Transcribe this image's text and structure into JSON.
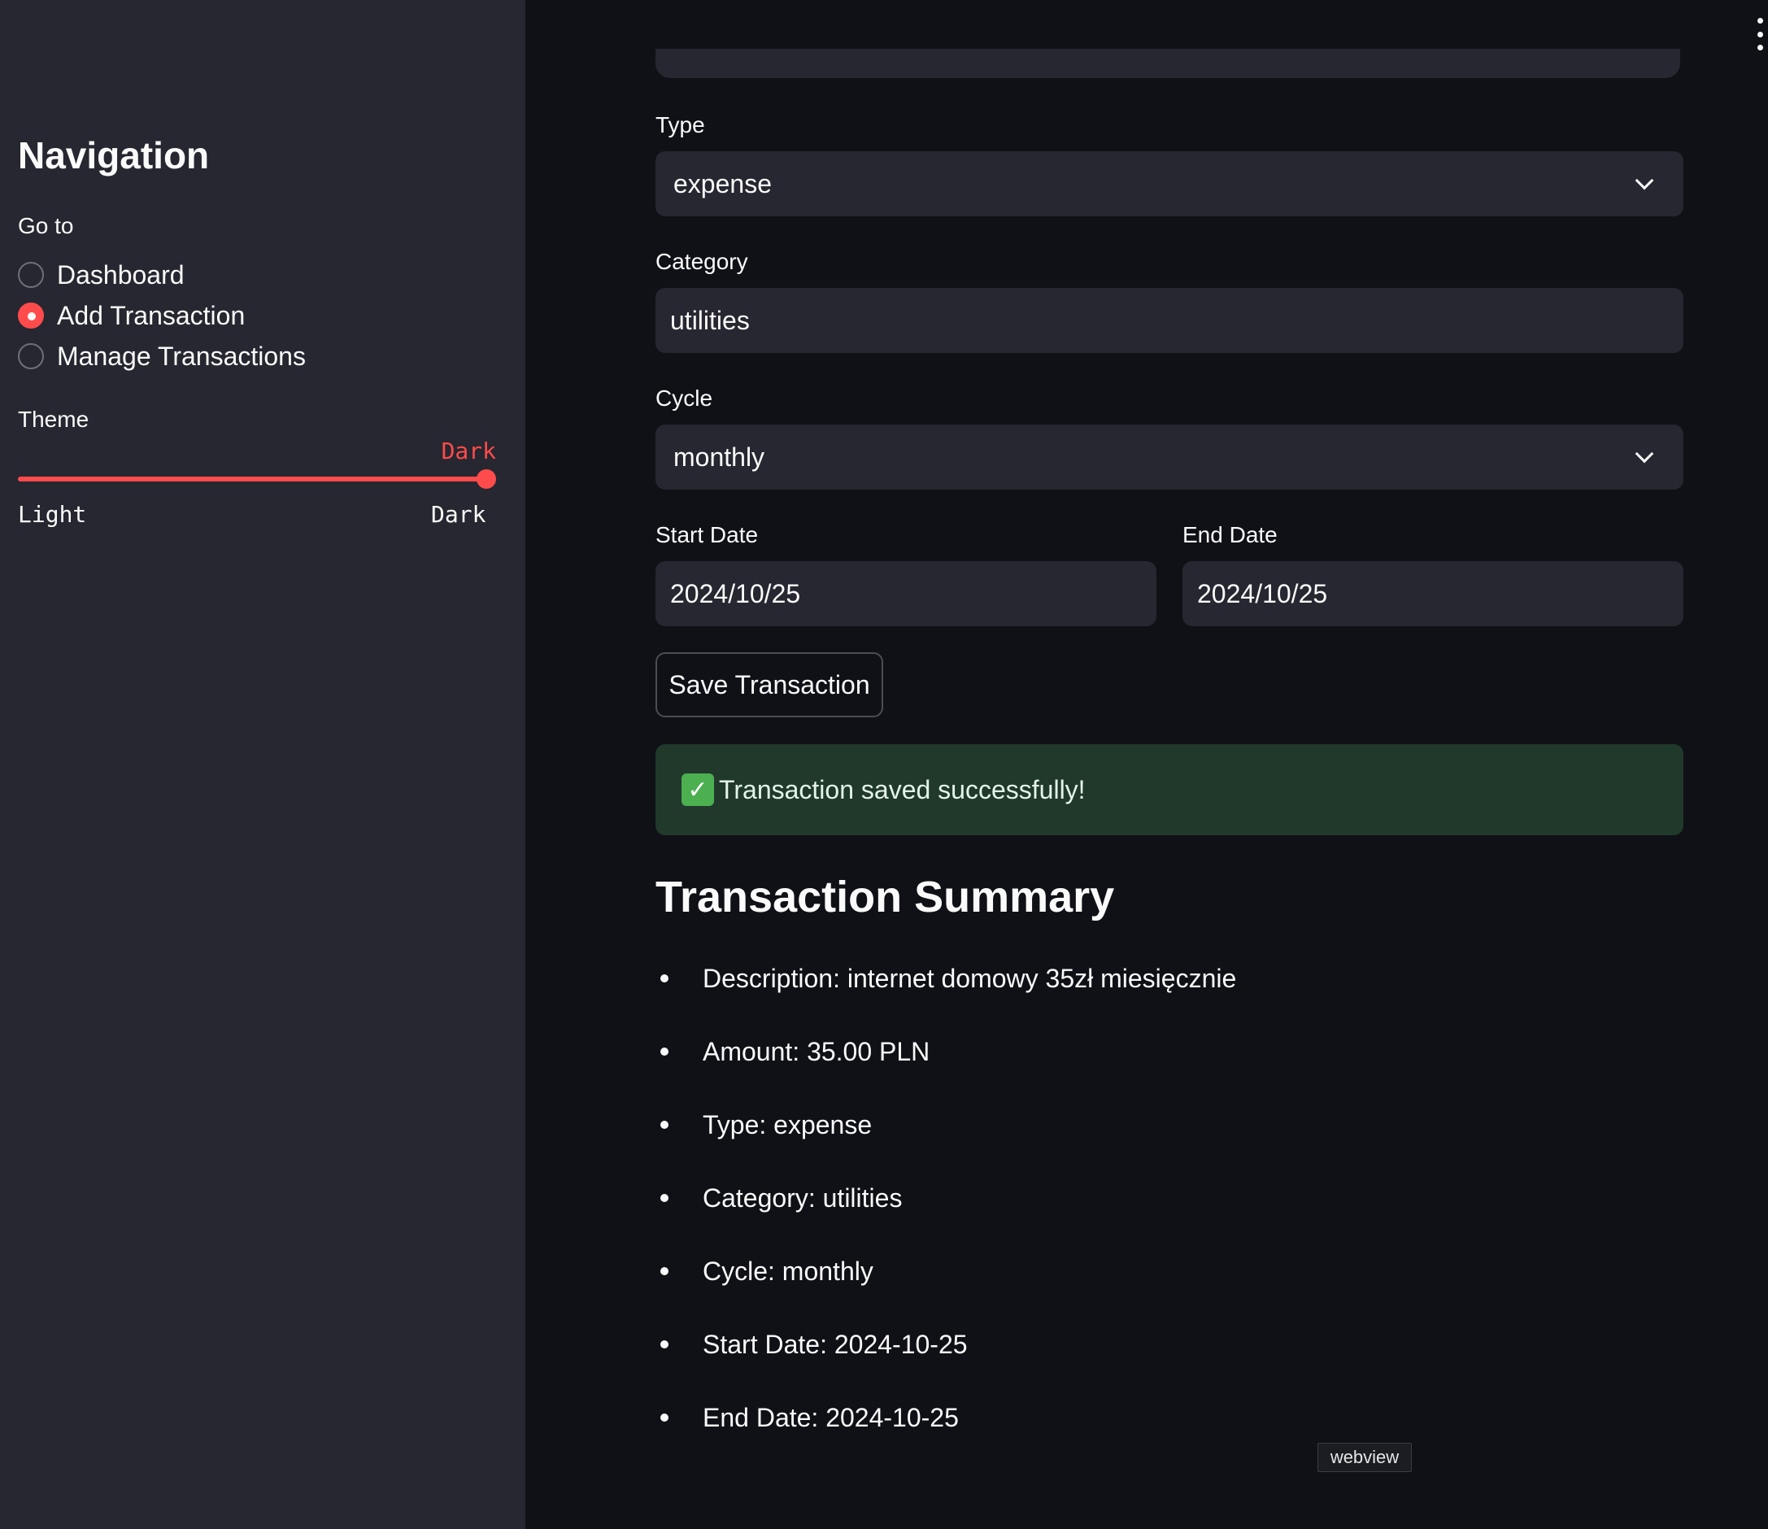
{
  "sidebar": {
    "title": "Navigation",
    "goto_label": "Go to",
    "items": [
      {
        "label": "Dashboard",
        "selected": false
      },
      {
        "label": "Add Transaction",
        "selected": true
      },
      {
        "label": "Manage Transactions",
        "selected": false
      }
    ],
    "theme": {
      "label": "Theme",
      "value": "Dark",
      "min_label": "Light",
      "max_label": "Dark",
      "options": [
        "Light",
        "Dark"
      ],
      "level": 1.0
    }
  },
  "form": {
    "type": {
      "label": "Type",
      "value": "expense"
    },
    "category": {
      "label": "Category",
      "value": "utilities"
    },
    "cycle": {
      "label": "Cycle",
      "value": "monthly"
    },
    "start_date": {
      "label": "Start Date",
      "value": "2024/10/25"
    },
    "end_date": {
      "label": "End Date",
      "value": "2024/10/25"
    },
    "save_label": "Save Transaction"
  },
  "alert": {
    "icon": "check-mark-icon",
    "text": "Transaction saved successfully!"
  },
  "summary": {
    "title": "Transaction Summary",
    "items": [
      "Description: internet domowy 35zł miesięcznie",
      "Amount: 35.00 PLN",
      "Type: expense",
      "Category: utilities",
      "Cycle: monthly",
      "Start Date: 2024-10-25",
      "End Date: 2024-10-25"
    ]
  },
  "webview_tag": "webview",
  "colors": {
    "accent": "#ff4b4b",
    "background": "#0f1117",
    "sidebar": "#262730",
    "success_bg": "#21392b"
  }
}
